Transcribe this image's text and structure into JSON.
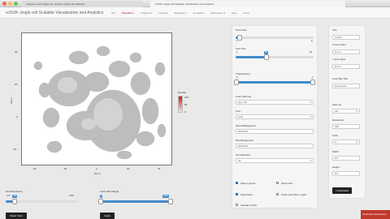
{
  "browser": {
    "tabs": [
      "cellxgene web single cell - Explore single cell datasets",
      "scSVA: single cell Scalable Visualization and Analytics"
    ]
  },
  "navbar": {
    "brand": "scSVA: single cell Scalable Visualization and Analytics",
    "items": [
      {
        "label": "Get",
        "active": false
      },
      {
        "label": "Visualize ▾",
        "active": true
      },
      {
        "label": "Analytics ▾",
        "active": false
      },
      {
        "label": "Layout ▾",
        "active": false
      },
      {
        "label": "Metadata ▾",
        "active": false
      },
      {
        "label": "Annotation",
        "active": false
      },
      {
        "label": "Expression ▾",
        "active": false
      },
      {
        "label": "Help",
        "active": false
      },
      {
        "label": "About",
        "active": false
      }
    ]
  },
  "plot": {
    "xlabel": "Dim 1",
    "ylabel": "Dim 2",
    "xticks": [
      "-40",
      "-20",
      "0",
      "20",
      "40"
    ],
    "yticks": [
      "40",
      "20",
      "0",
      "-20"
    ],
    "legend_title": "Density",
    "legend_ticks": [
      "100",
      "50",
      "0"
    ]
  },
  "bottom_controls": {
    "grid_resolution": {
      "label": "Grid Resolution",
      "min": "100",
      "max": "3000",
      "value": "350",
      "level": 0.12
    },
    "color_range": {
      "label": "Color Max Range",
      "min": "0",
      "max": "1000",
      "value_low": "0",
      "value_high": "1000"
    },
    "reset_button": "Reset View",
    "apply_button": "Apply"
  },
  "middle_panel": {
    "point_size": {
      "label": "Point Size",
      "min": "1",
      "max": "5",
      "value": "1",
      "level": 0.05
    },
    "font_size": {
      "label": "Font Size",
      "min": "1",
      "max": "25",
      "value": "11",
      "level": 0.4
    },
    "transparency": {
      "label": "Transparency",
      "min": "0",
      "max": "1",
      "value_low": "0",
      "value_high": "1"
    },
    "color_scheme": {
      "label": "Color Scheme",
      "value": "grey-red"
    },
    "font": {
      "label": "Font",
      "value": "Arial"
    },
    "panel_background": {
      "label": "Panel Background",
      "value": "#FFFFFF"
    },
    "plot_background": {
      "label": "Plot Background",
      "value": "#FFFFFF"
    },
    "normalization": {
      "label": "Normalization",
      "value": "No"
    },
    "checkboxes": [
      {
        "label": "Show Legend",
        "checked": true
      },
      {
        "label": "Show Grid",
        "checked": false
      },
      {
        "label": "Show Axes",
        "checked": true
      },
      {
        "label": "Scale Color Bar, Log10",
        "checked": false
      },
      {
        "label": "Upscale Points",
        "checked": false
      }
    ]
  },
  "right_panel": {
    "title": {
      "label": "Title",
      "value": "scSVA"
    },
    "x_label": {
      "label": "X-axis Label",
      "value": "Dim 1"
    },
    "y_label": {
      "label": "Y-axis Label",
      "value": "Dim 2"
    },
    "legend_title": {
      "label": "Color Bar Title",
      "value": "Expression"
    },
    "save_as": {
      "label": "Save as",
      "value": "pdf"
    },
    "resolution": {
      "label": "Resolution",
      "value": "300"
    },
    "units": {
      "label": "Units",
      "value": "in"
    },
    "width": {
      "label": "Width",
      "value": "8.5"
    },
    "height": {
      "label": "Height",
      "value": "8.5"
    },
    "download_button": "Download"
  },
  "corner_badge": "Connecting Data Explorer",
  "colors": {
    "accent": "#428bca",
    "active_nav": "#c0392b",
    "density_high": "#c81e1e",
    "density_low": "#e8e8e8"
  }
}
